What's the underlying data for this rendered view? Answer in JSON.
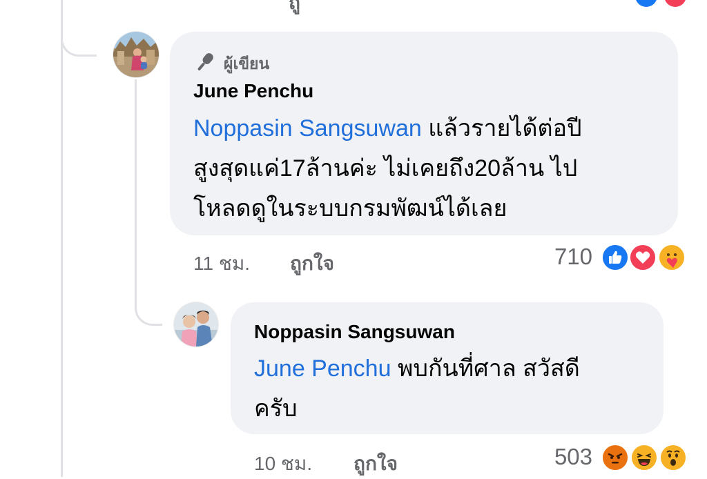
{
  "thread": {
    "top_partial_text": "ถู"
  },
  "comments": [
    {
      "author_badge_label": "ผู้เขียน",
      "author": "June Penchu",
      "mention": "Noppasin Sangsuwan",
      "text_line1": " แล้วรายได้ต่อปี",
      "text_line2": "สูงสุดแค่17ล้านค่ะ ไม่เคยถึง20ล้าน ไป",
      "text_line3": "โหลดดูในระบบกรมพัฒน์ได้เลย",
      "time": "11 ชม.",
      "like_label": "ถูกใจ",
      "reaction_count": "710",
      "reactions": [
        "like-icon",
        "love-icon",
        "care-icon"
      ]
    },
    {
      "author": "Noppasin Sangsuwan",
      "mention": "June Penchu",
      "text_line1": " พบกันที่ศาล สวัสดี",
      "text_line2": "ครับ",
      "time": "10 ชม.",
      "like_label": "ถูกใจ",
      "reaction_count": "503",
      "reactions": [
        "angry-icon",
        "haha-icon",
        "wow-icon"
      ]
    }
  ],
  "colors": {
    "bubble": "#f0f2f5",
    "mention": "#216fdb",
    "meta": "#65676b",
    "like_blue": "#1877f2",
    "love_red": "#f33e58",
    "angry_orange": "#e9710f",
    "emoji_yellow": "#f7b125"
  }
}
